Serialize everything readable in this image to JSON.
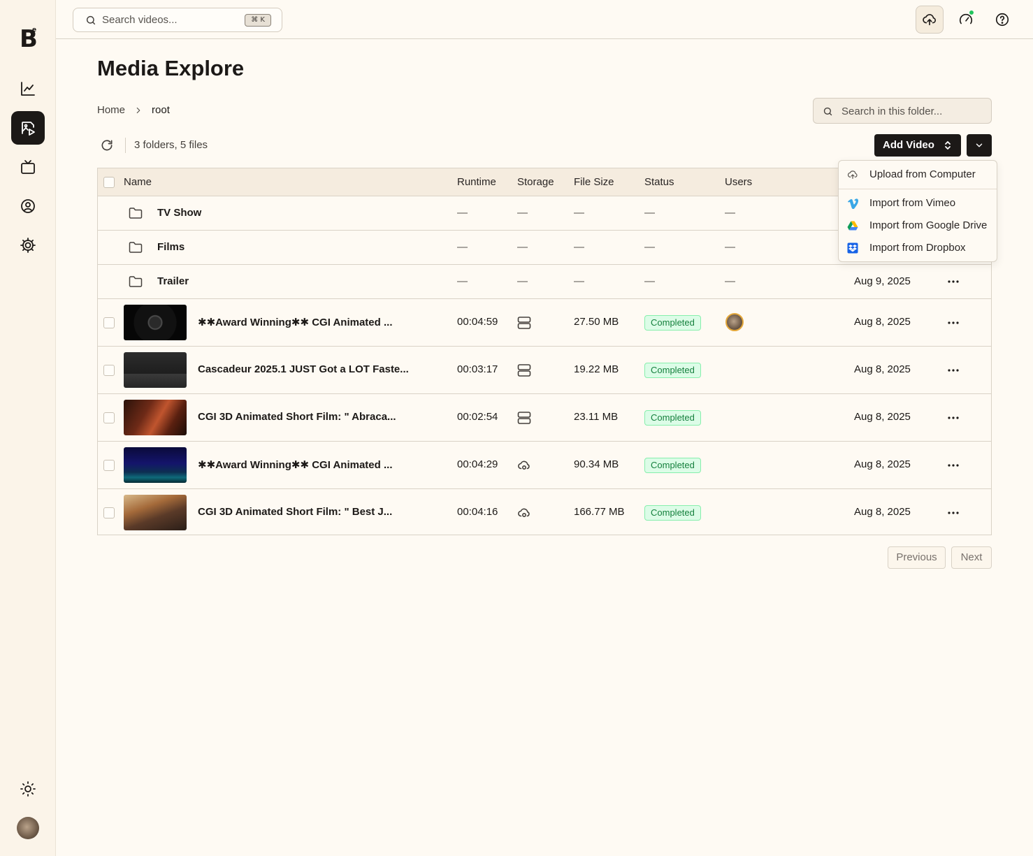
{
  "app": {
    "logo_letter": "B",
    "logo_sup": "e"
  },
  "topbar": {
    "search_placeholder": "Search videos...",
    "shortcut": "⌘ K"
  },
  "page": {
    "title": "Media Explore",
    "breadcrumb": {
      "home": "Home",
      "current": "root"
    },
    "folder_search_placeholder": "Search in this folder...",
    "count": "3 folders, 5 files",
    "add_video_label": "Add Video"
  },
  "table": {
    "headers": {
      "name": "Name",
      "runtime": "Runtime",
      "storage": "Storage",
      "file_size": "File Size",
      "status": "Status",
      "users": "Users"
    },
    "folders": [
      {
        "name": "TV Show",
        "runtime": "—",
        "storage": "—",
        "size": "—",
        "status": "—",
        "users": "—",
        "date": ""
      },
      {
        "name": "Films",
        "runtime": "—",
        "storage": "—",
        "size": "—",
        "status": "—",
        "users": "—",
        "date": ""
      },
      {
        "name": "Trailer",
        "runtime": "—",
        "storage": "—",
        "size": "—",
        "status": "—",
        "users": "—",
        "date": "Aug 9, 2025"
      }
    ],
    "files": [
      {
        "name": "✱✱Award Winning✱✱ CGI Animated ...",
        "runtime": "00:04:59",
        "storage_icon": "server-icon",
        "size": "27.50 MB",
        "status": "Completed",
        "has_user": true,
        "date": "Aug 8, 2025"
      },
      {
        "name": "Cascadeur 2025.1 JUST Got a LOT Faste...",
        "runtime": "00:03:17",
        "storage_icon": "server-icon",
        "size": "19.22 MB",
        "status": "Completed",
        "has_user": false,
        "date": "Aug 8, 2025"
      },
      {
        "name": "CGI 3D Animated Short Film:    \" Abraca...",
        "runtime": "00:02:54",
        "storage_icon": "server-icon",
        "size": "23.11 MB",
        "status": "Completed",
        "has_user": false,
        "date": "Aug 8, 2025"
      },
      {
        "name": "✱✱Award Winning✱✱ CGI Animated ...",
        "runtime": "00:04:29",
        "storage_icon": "cloud-icon",
        "size": "90.34 MB",
        "status": "Completed",
        "has_user": false,
        "date": "Aug 8, 2025"
      },
      {
        "name": "CGI 3D Animated Short Film:    \" Best J...",
        "runtime": "00:04:16",
        "storage_icon": "cloud-icon",
        "size": "166.77 MB",
        "status": "Completed",
        "has_user": false,
        "date": "Aug 8, 2025"
      }
    ]
  },
  "menu": {
    "items": [
      {
        "label": "Upload from Computer",
        "icon": "cloud-upload-icon"
      },
      {
        "label": "Import from Vimeo",
        "icon": "vimeo-icon"
      },
      {
        "label": "Import from Google Drive",
        "icon": "google-drive-icon"
      },
      {
        "label": "Import from Dropbox",
        "icon": "dropbox-icon"
      }
    ]
  },
  "pagination": {
    "previous": "Previous",
    "next": "Next"
  },
  "colors": {
    "accent": "#1c1917",
    "background": "#fefaf3",
    "completed_bg": "#dcfce7",
    "completed_text": "#15803d",
    "online_dot": "#22c55e"
  }
}
